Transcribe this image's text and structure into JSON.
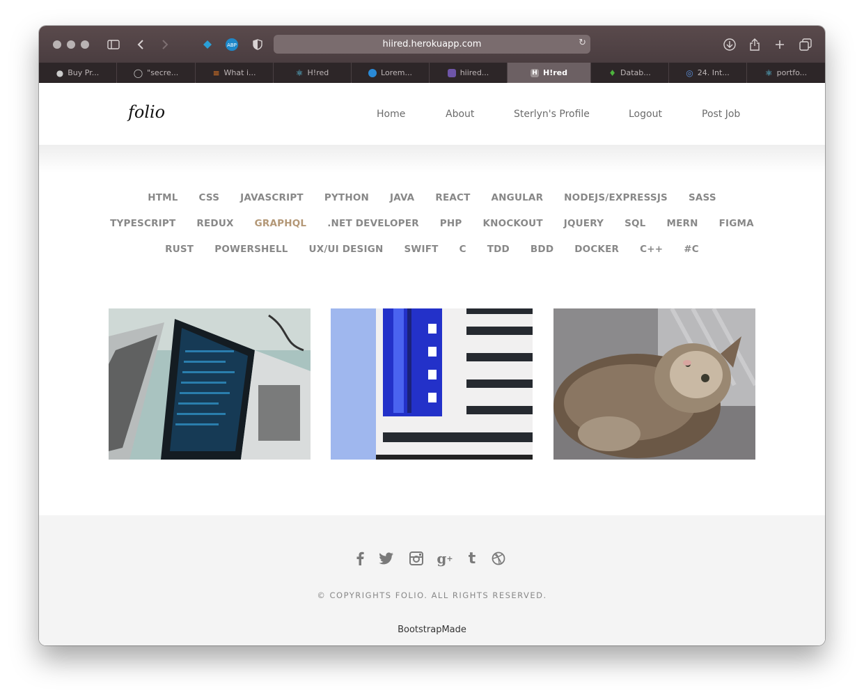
{
  "browser": {
    "url": "hiired.herokuapp.com",
    "tabs": [
      {
        "label": "Buy Pr...",
        "icon": "apple-icon"
      },
      {
        "label": "\"secre...",
        "icon": "chat-icon"
      },
      {
        "label": "What i...",
        "icon": "stackoverflow-icon"
      },
      {
        "label": "H!red",
        "icon": "react-icon"
      },
      {
        "label": "Lorem...",
        "icon": "circle-icon"
      },
      {
        "label": "hiired...",
        "icon": "heroku-icon"
      },
      {
        "label": "H!red",
        "icon": "h-icon",
        "active": true
      },
      {
        "label": "Datab...",
        "icon": "mongodb-icon"
      },
      {
        "label": "24. Int...",
        "icon": "globe-icon"
      },
      {
        "label": "portfo...",
        "icon": "react-icon"
      }
    ]
  },
  "site": {
    "logo": "folio",
    "nav": [
      "Home",
      "About",
      "Sterlyn's Profile",
      "Logout",
      "Post Job"
    ]
  },
  "filters": {
    "rows": [
      [
        "HTML",
        "CSS",
        "JAVASCRIPT",
        "PYTHON",
        "JAVA",
        "REACT",
        "ANGULAR",
        "NODEJS/EXPRESSJS",
        "SASS"
      ],
      [
        "TYPESCRIPT",
        "REDUX",
        "GRAPHQL",
        ".NET DEVELOPER",
        "PHP",
        "KNOCKOUT",
        "JQUERY",
        "SQL",
        "MERN",
        "FIGMA"
      ],
      [
        "RUST",
        "POWERSHELL",
        "UX/UI DESIGN",
        "SWIFT",
        "C",
        "TDD",
        "BDD",
        "DOCKER",
        "C++",
        "#C"
      ]
    ],
    "active": "GRAPHQL",
    "active_color": "#b39776"
  },
  "gallery": [
    "laptop-code-image",
    "blue-building-image",
    "fluffy-cat-image"
  ],
  "footer": {
    "social_icons": [
      "facebook-icon",
      "twitter-icon",
      "instagram-icon",
      "google-plus-icon",
      "tumblr-icon",
      "dribbble-icon"
    ],
    "copyright": "© COPYRIGHTS FOLIO. ALL RIGHTS RESERVED.",
    "credit": "BootstrapMade"
  }
}
